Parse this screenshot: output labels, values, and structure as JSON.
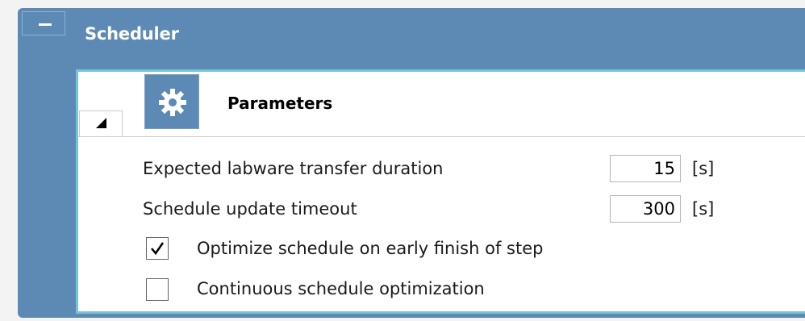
{
  "panel": {
    "title": "Scheduler"
  },
  "section": {
    "title": "Parameters"
  },
  "fields": [
    {
      "label": "Expected labware transfer duration",
      "value": "15",
      "unit": "[s]"
    },
    {
      "label": "Schedule update timeout",
      "value": "300",
      "unit": "[s]"
    }
  ],
  "options": [
    {
      "label": "Optimize schedule on early finish of step",
      "checked": true
    },
    {
      "label": "Continuous schedule optimization",
      "checked": false
    }
  ],
  "icons": {
    "collapse": "minus-icon",
    "expand_toggle": "triangle-left-icon",
    "section": "gear-icon"
  },
  "colors": {
    "header": "#5d8ab5",
    "border": "#74c4d6"
  }
}
